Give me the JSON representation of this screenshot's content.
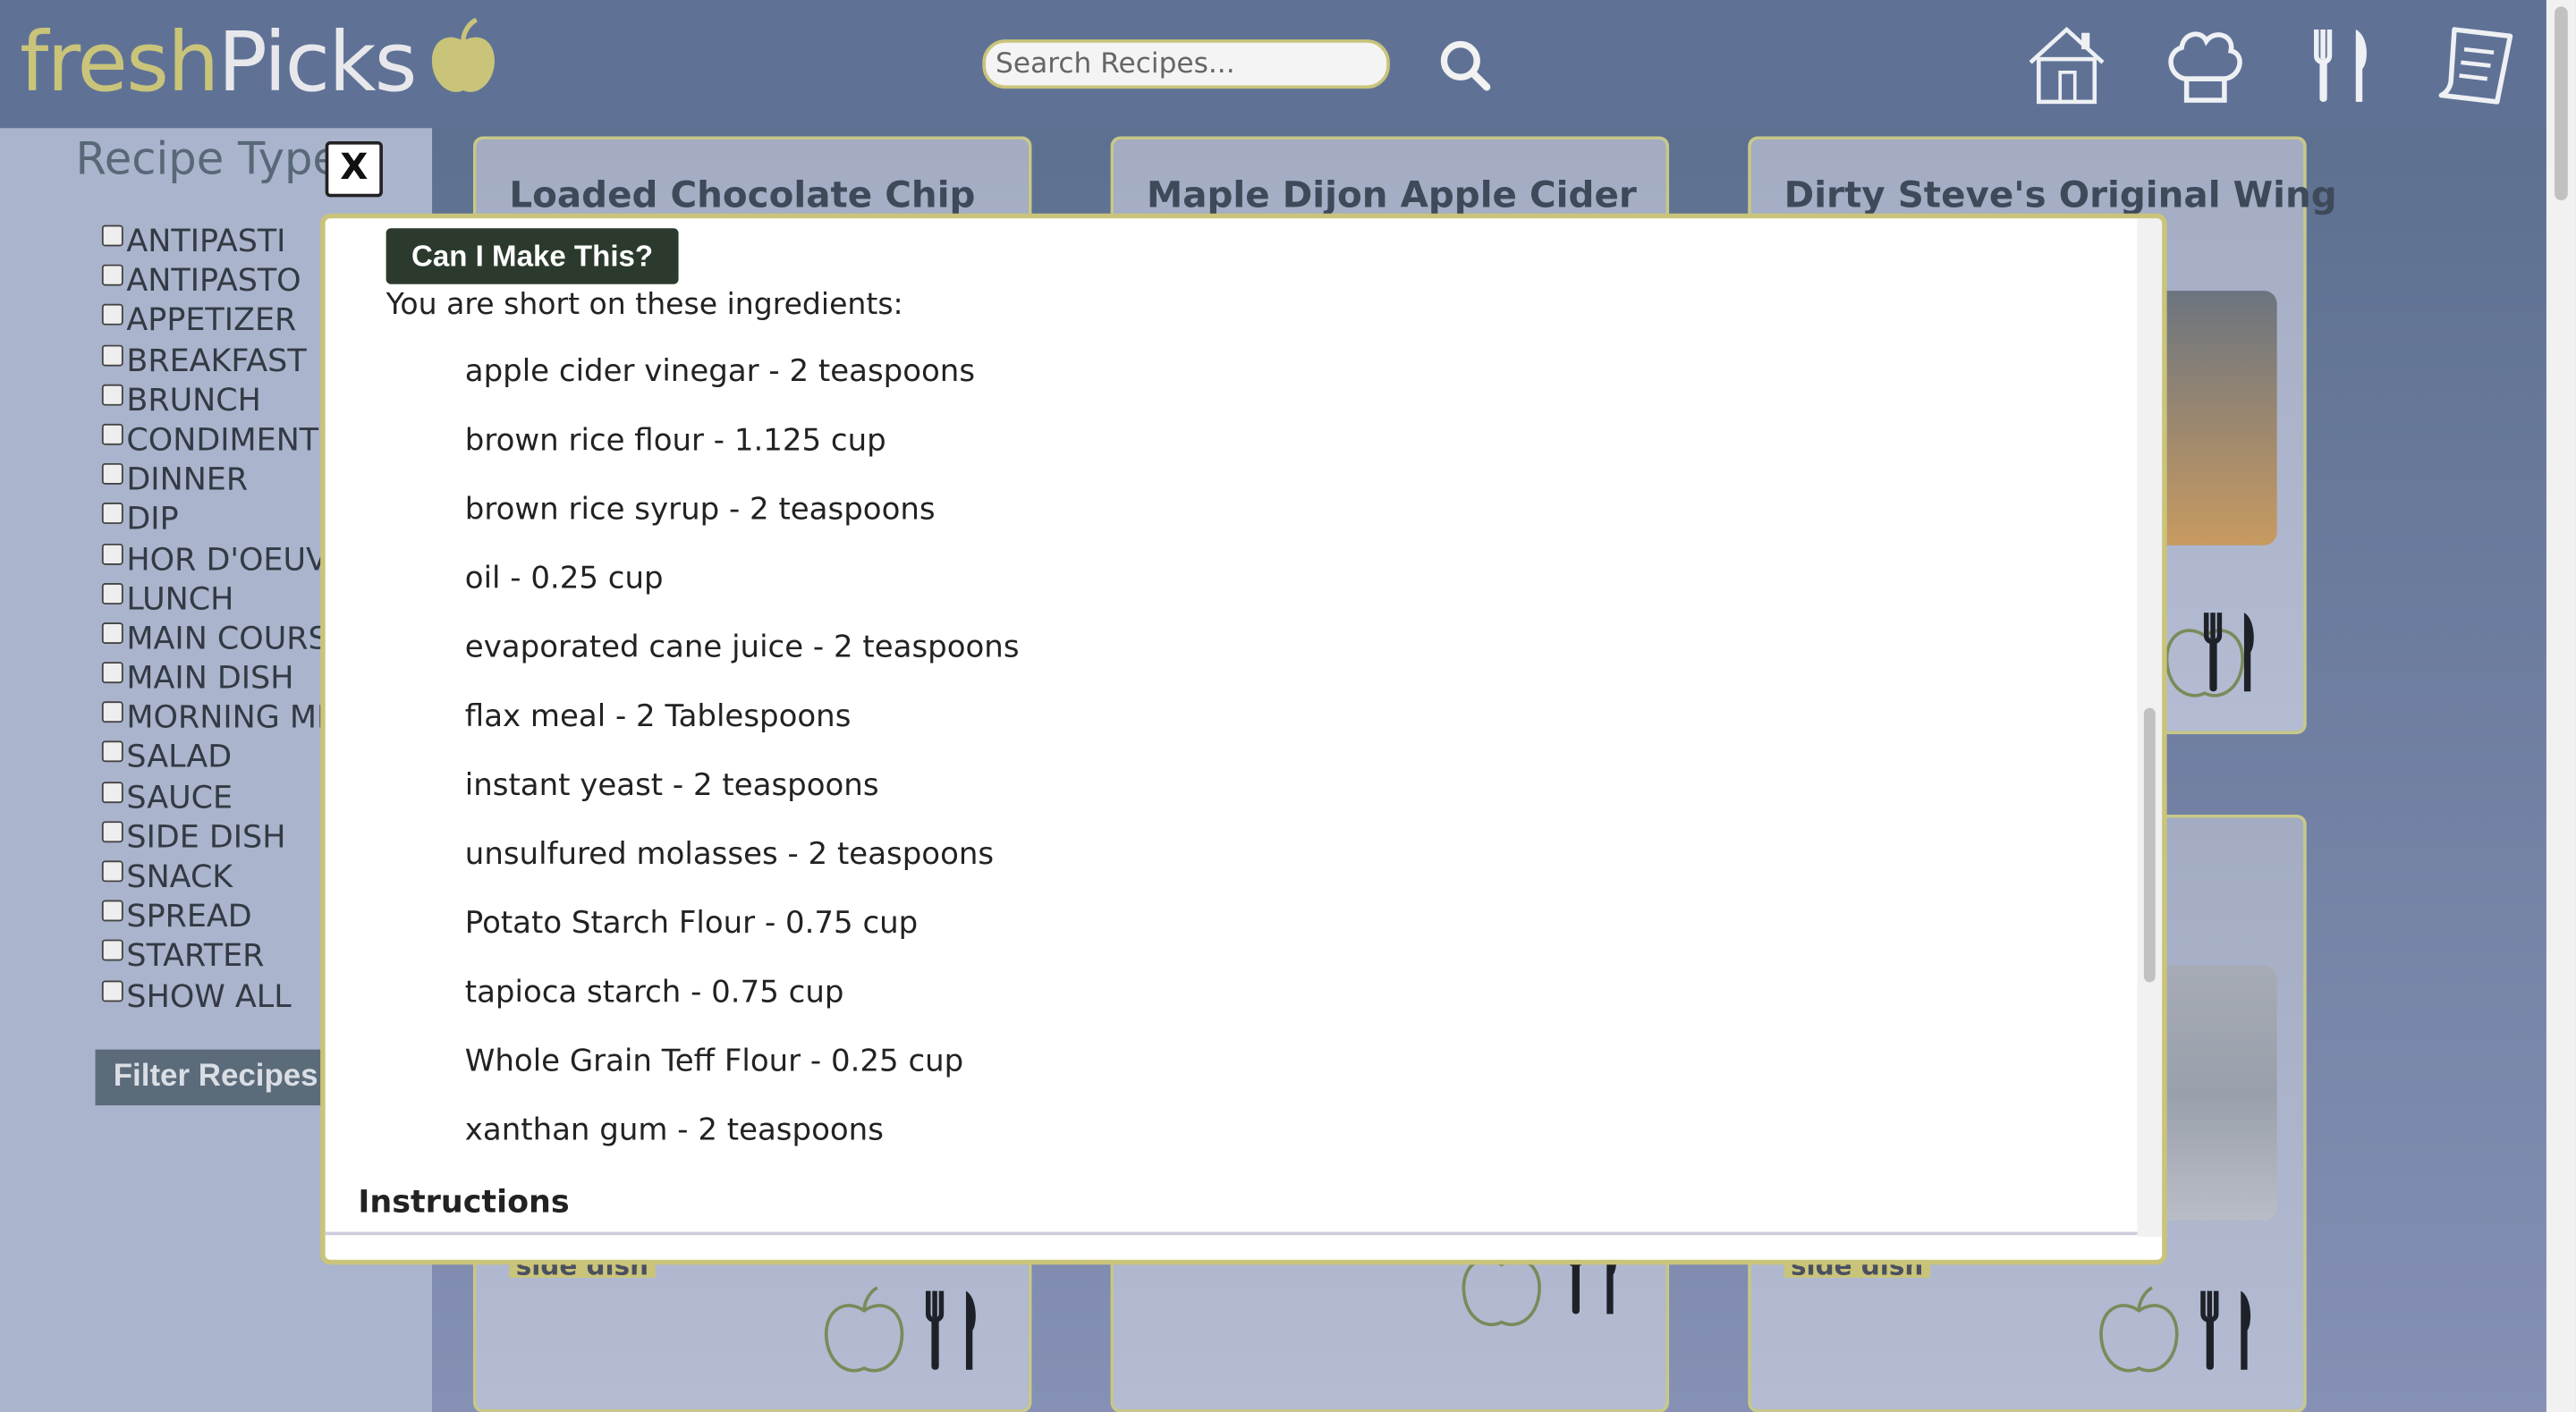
{
  "header": {
    "logo_fresh": "fresh",
    "logo_picks": "Picks",
    "search_placeholder": "Search Recipes..."
  },
  "sidebar": {
    "title": "Recipe Type",
    "types": [
      "ANTIPASTI",
      "ANTIPASTO",
      "APPETIZER",
      "BREAKFAST",
      "BRUNCH",
      "CONDIMENT",
      "DINNER",
      "DIP",
      "HOR D'OEUVRE",
      "LUNCH",
      "MAIN COURSE",
      "MAIN DISH",
      "MORNING MEAL",
      "SALAD",
      "SAUCE",
      "SIDE DISH",
      "SNACK",
      "SPREAD",
      "STARTER",
      "SHOW ALL"
    ],
    "filter_label": "Filter Recipes"
  },
  "cards": [
    {
      "title": "Loaded Chocolate Chip",
      "tag": "side dish"
    },
    {
      "title": "Maple Dijon Apple Cider",
      "tag": ""
    },
    {
      "title": "Dirty Steve's Original Wing",
      "tag": "side dish"
    }
  ],
  "modal": {
    "close_label": "X",
    "can_make_label": "Can I Make This?",
    "short_text": "You are short on these ingredients:",
    "ingredients": [
      "apple cider vinegar - 2 teaspoons",
      "brown rice flour - 1.125 cup",
      "brown rice syrup - 2 teaspoons",
      "oil - 0.25 cup",
      "evaporated cane juice - 2 teaspoons",
      "flax meal - 2 Tablespoons",
      "instant yeast - 2 teaspoons",
      "unsulfured molasses - 2 teaspoons",
      "Potato Starch Flour - 0.75 cup",
      "tapioca starch - 0.75 cup",
      "Whole Grain Teff Flour - 0.25 cup",
      "xanthan gum - 2 teaspoons"
    ],
    "instructions_heading": "Instructions"
  },
  "colors": {
    "header_bg": "#5f7296",
    "accent": "#c9c47a",
    "sidebar_bg": "#aab4cc",
    "button_dark": "#2b3a2c"
  },
  "icons": [
    "apple-logo-icon",
    "search-icon",
    "home-icon",
    "chef-hat-icon",
    "utensils-icon",
    "recipe-list-icon"
  ]
}
